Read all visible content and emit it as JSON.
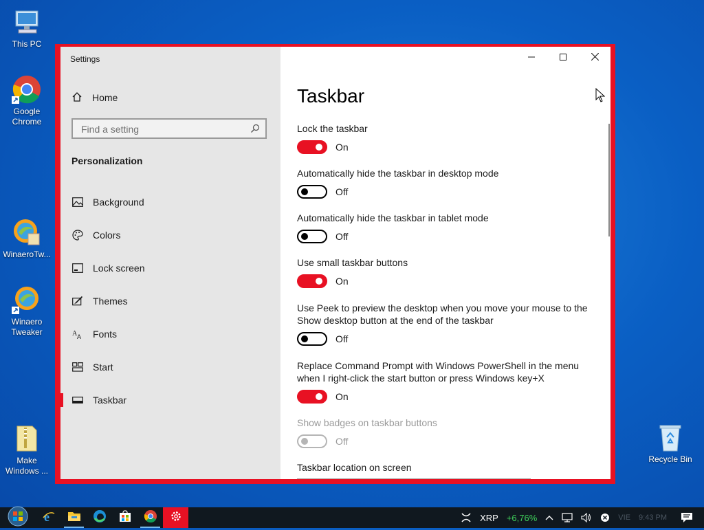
{
  "desktop": {
    "icons": [
      {
        "label": "This PC"
      },
      {
        "label": "Google Chrome"
      },
      {
        "label": "WinaeroTw..."
      },
      {
        "label": "Winaero Tweaker"
      },
      {
        "label": "Make Windows ..."
      },
      {
        "label": "Recycle Bin"
      }
    ]
  },
  "window": {
    "app_title": "Settings",
    "accent_color": "#e81123",
    "caption": {
      "minimize": "minimize-icon",
      "maximize": "maximize-icon",
      "close": "close-icon"
    }
  },
  "sidebar": {
    "home_label": "Home",
    "search_placeholder": "Find a setting",
    "section_title": "Personalization",
    "items": [
      {
        "label": "Background",
        "icon": "image-icon"
      },
      {
        "label": "Colors",
        "icon": "palette-icon"
      },
      {
        "label": "Lock screen",
        "icon": "lock-screen-icon"
      },
      {
        "label": "Themes",
        "icon": "themes-icon"
      },
      {
        "label": "Fonts",
        "icon": "fonts-icon"
      },
      {
        "label": "Start",
        "icon": "start-icon"
      },
      {
        "label": "Taskbar",
        "icon": "taskbar-icon",
        "active": true
      }
    ]
  },
  "main": {
    "title": "Taskbar",
    "settings": [
      {
        "label": "Lock the taskbar",
        "state": "On"
      },
      {
        "label": "Automatically hide the taskbar in desktop mode",
        "state": "Off"
      },
      {
        "label": "Automatically hide the taskbar in tablet mode",
        "state": "Off"
      },
      {
        "label": "Use small taskbar buttons",
        "state": "On"
      },
      {
        "label": "Use Peek to preview the desktop when you move your mouse to the Show desktop button at the end of the taskbar",
        "state": "Off"
      },
      {
        "label": "Replace Command Prompt with Windows PowerShell in the menu when I right-click the start button or press Windows key+X",
        "state": "On"
      },
      {
        "label": "Show badges on taskbar buttons",
        "state": "Off",
        "disabled": true
      }
    ],
    "location_label": "Taskbar location on screen"
  },
  "taskbar": {
    "apps": [
      "internet-explorer-icon",
      "file-explorer-icon",
      "edge-icon",
      "store-icon",
      "chrome-icon",
      "settings-icon"
    ],
    "ticker_symbol": "XRP",
    "ticker_change": "+6,76%",
    "language": "VIE",
    "time": "9:43 PM"
  }
}
